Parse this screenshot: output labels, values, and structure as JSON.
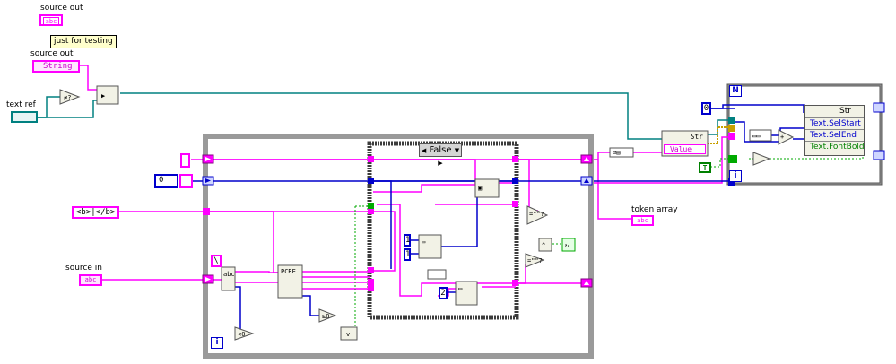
{
  "labels": {
    "source_out_top": "source out",
    "source_out_ctl": "source out",
    "text_ref": "text ref",
    "source_in": "source in",
    "token_array": "token array"
  },
  "note": "just for testing",
  "terminals": {
    "abc": "abc",
    "string_ctl": "String",
    "bold_tags": "<b>|</b>",
    "zero": "0",
    "one": "1",
    "two": "2",
    "true_const": "T",
    "value": "Value",
    "str": "Str",
    "n": "N",
    "i": "i",
    "backslash": "\\"
  },
  "case_selector": {
    "value": "False",
    "left_arrow": "◀",
    "dropdown": "▼",
    "right_arrow": "▶"
  },
  "property_node": {
    "header": "Str",
    "rows": [
      "Text.SelStart",
      "Text.SelEnd",
      "Text.FontBold"
    ]
  },
  "colors": {
    "string_wire": "#ff00ff",
    "numeric_wire": "#0000cc",
    "boolean_wire": "#00aa00",
    "ref_wire": "#008080",
    "while_loop_border": "#9a9a9a",
    "case_border": "#3c3c3c",
    "for_loop_border": "#555555"
  }
}
